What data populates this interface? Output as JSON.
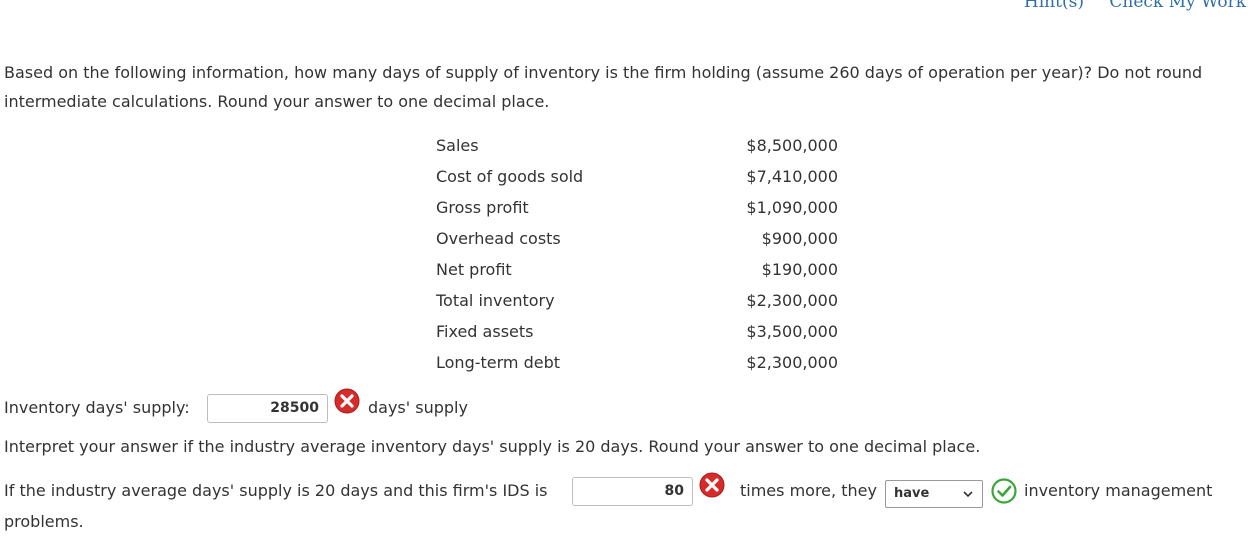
{
  "header": {
    "hints_label": "Hint(s)",
    "check_label": "Check My Work"
  },
  "question": {
    "text": "Based on the following information, how many days of supply of inventory is the firm holding (assume 260 days of operation per year)? Do not round intermediate calculations. Round your answer to one decimal place."
  },
  "financials": [
    {
      "label": "Sales",
      "value": "$8,500,000"
    },
    {
      "label": "Cost of goods sold",
      "value": "$7,410,000"
    },
    {
      "label": "Gross profit",
      "value": "$1,090,000"
    },
    {
      "label": "Overhead costs",
      "value": "$900,000"
    },
    {
      "label": "Net profit",
      "value": "$190,000"
    },
    {
      "label": "Total inventory",
      "value": "$2,300,000"
    },
    {
      "label": "Fixed assets",
      "value": "$3,500,000"
    },
    {
      "label": "Long-term debt",
      "value": "$2,300,000"
    }
  ],
  "answer1": {
    "label": "Inventory days' supply:",
    "value": "28500",
    "suffix": "days' supply",
    "status": "incorrect"
  },
  "interpret": {
    "text": "Interpret your answer if the industry average inventory days' supply is 20 days. Round your answer to one decimal place."
  },
  "answer2": {
    "prefix": "If the industry average days' supply is 20 days and this firm's IDS is",
    "value": "80",
    "status": "incorrect",
    "middle": "times more, they",
    "select_value": "have",
    "select_status": "correct",
    "suffix": "inventory management",
    "wrap": "problems."
  },
  "colors": {
    "link": "#2f6fa6",
    "error": "#d62b2b",
    "success": "#3aa63a"
  }
}
